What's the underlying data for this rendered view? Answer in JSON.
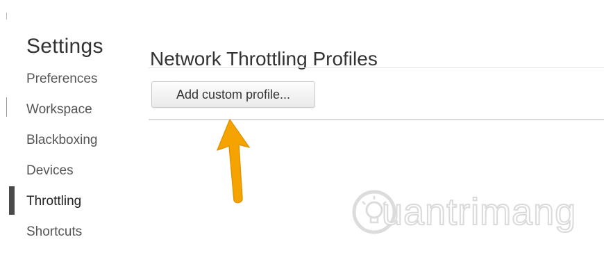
{
  "sidebar": {
    "title": "Settings",
    "items": [
      {
        "label": "Preferences"
      },
      {
        "label": "Workspace"
      },
      {
        "label": "Blackboxing"
      },
      {
        "label": "Devices"
      },
      {
        "label": "Throttling",
        "active": true
      },
      {
        "label": "Shortcuts"
      }
    ]
  },
  "main": {
    "title": "Network Throttling Profiles",
    "add_button_label": "Add custom profile..."
  },
  "annotation": {
    "arrow_icon": "arrow-up-icon",
    "arrow_color": "#F5A300"
  },
  "watermark": {
    "text": "uantrimang",
    "icon": "lightbulb-icon"
  },
  "colors": {
    "active_marker": "#4A4A4A",
    "divider": "#DADADA",
    "text": "#333333"
  }
}
